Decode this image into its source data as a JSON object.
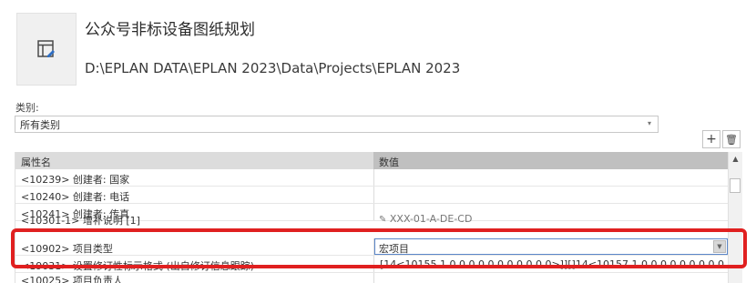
{
  "project": {
    "name": "公众号非标设备图纸规划",
    "path": "D:\\EPLAN DATA\\EPLAN 2023\\Data\\Projects\\EPLAN 2023",
    "icon": "project-page-icon"
  },
  "category": {
    "label": "类别:",
    "value": "所有类别"
  },
  "buttons": {
    "add": "+",
    "delete": "🗑"
  },
  "grid": {
    "headers": {
      "name": "属性名",
      "value": "数值"
    },
    "rows": [
      {
        "name": "<10239> 创建者: 国家",
        "value": ""
      },
      {
        "name": "<10240> 创建者: 电话",
        "value": ""
      },
      {
        "name": "<10241> 创建者: 传真",
        "value": ""
      },
      {
        "name": "<10301-1> 增补说明 [1]",
        "value": "XXX-01-A-DE-CD"
      },
      {
        "name": "<10902> 项目类型",
        "value": "宏项目"
      },
      {
        "name": "<19031> 设置修订性标示格式 (出自修订信息跟踪)",
        "value": "[14<10155 1,0,0,0,0,0,0,0,0,0,0,0>]][]14<10157 1,0,0,0,0,0,0,0,0,0,0,0>]][]"
      },
      {
        "name": "<10025> 项目负责人",
        "value": ""
      }
    ]
  },
  "colors": {
    "highlight": "#e02020",
    "header_value_bg": "#c0c0c0",
    "combo_border": "#5b87c9"
  }
}
